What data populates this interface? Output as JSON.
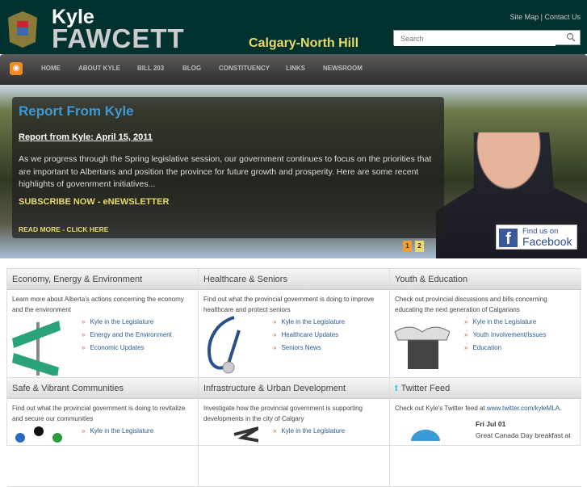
{
  "header": {
    "first_name": "Kyle",
    "last_name": "FAWCETT",
    "riding": "Calgary-North Hill",
    "site_map": "Site Map",
    "separator": "|",
    "contact": "Contact Us",
    "search_placeholder": "Search"
  },
  "nav": [
    "HOME",
    "ABOUT KYLE",
    "BILL 203",
    "BLOG",
    "CONSTITUENCY",
    "LINKS",
    "NEWSROOM"
  ],
  "hero": {
    "title": "Report From Kyle",
    "date_link": "Report from Kyle: April 15, 2011",
    "body": "As we progress through the Spring legislative session, our government continues to focus on the priorities that are important to Albertans and position the province for future growth and prosperity. Here are some recent highlights of govenrment initiatives...",
    "subscribe": "SUBSCRIBE NOW - eNEWSLETTER",
    "read_more": "READ MORE - CLICK HERE",
    "pages": [
      "1",
      "2"
    ],
    "facebook_line1": "Find us on",
    "facebook_line2": "Facebook"
  },
  "boxes": [
    {
      "title": "Economy, Energy & Environment",
      "desc": "Learn more about Alberta's actions concerning the economy and the environment",
      "links": [
        "Kyle in the Legislature",
        "Energy and the Environment",
        "Economic Updates"
      ]
    },
    {
      "title": "Healthcare & Seniors",
      "desc": "Find out what the provincial government is doing to improve healthcare and protect seniors",
      "links": [
        "Kyle in the Legislature",
        "Healthcare Updates",
        "Seniors News"
      ]
    },
    {
      "title": "Youth & Education",
      "desc": "Check out provincial discussions and bills concerning educating the next generation of Calgarians",
      "links": [
        "Kyle in the Legislature",
        "Youth Involvement/Issues",
        "Education"
      ]
    },
    {
      "title": "Safe & Vibrant Communities",
      "desc": "Find out what the provincial government is doing to revitalize and secure our communities",
      "links": [
        "Kyle in the Legislature"
      ]
    },
    {
      "title": "Infrastructure & Urban Development",
      "desc": "Investigate how the provincial government is supporting developments in the city of Calgary",
      "links": [
        "Kyle in the Legislature"
      ]
    }
  ],
  "twitter": {
    "title": "Twitter Feed",
    "desc": "Check out Kyle's Twitter feed at",
    "link": "www.twitter.com/kyleMLA.",
    "date": "Fri Jul 01",
    "tweet": "Great Canada Day breakfast at"
  }
}
